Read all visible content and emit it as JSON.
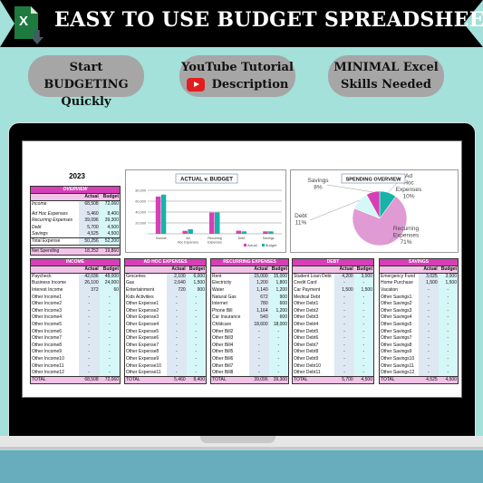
{
  "banner": {
    "title": "EASY TO USE BUDGET SPREADSHEET",
    "icon": "excel-download-icon"
  },
  "pills": [
    {
      "line1": "Start BUDGETING",
      "line2": "Quickly"
    },
    {
      "line1": "YouTube Tutorial",
      "line2": "Description",
      "icon": "youtube-icon"
    },
    {
      "line1": "MINIMAL Excel",
      "line2": "Skills Needed"
    }
  ],
  "sheet": {
    "year": "2023",
    "overview": {
      "title": "OVERVIEW",
      "col_actual": "Actual",
      "col_budget": "Budget",
      "rows": [
        {
          "label": "Income",
          "actual": "68,508",
          "budget": "72,060"
        },
        {
          "label": "Ad Hoc Expenses",
          "actual": "5,460",
          "budget": "8,400"
        },
        {
          "label": "Recurring Expenses",
          "actual": "39,096",
          "budget": "39,300"
        },
        {
          "label": "Debt",
          "actual": "5,700",
          "budget": "4,500"
        },
        {
          "label": "Savings",
          "actual": "4,525",
          "budget": "4,500"
        }
      ],
      "total": {
        "label": "Total Expense",
        "actual": "50,256",
        "budget": "52,200"
      },
      "net": {
        "label": "Net Spending",
        "actual": "18,252",
        "budget": "19,860"
      }
    },
    "sections": [
      {
        "title": "INCOME",
        "rows": [
          [
            "Paycheck",
            "42,036",
            "48,000"
          ],
          [
            "Business Income",
            "26,100",
            "24,000"
          ],
          [
            "Interest Income",
            "372",
            "60"
          ],
          [
            "Other Income1",
            "-",
            "-"
          ],
          [
            "Other Income2",
            "-",
            "-"
          ],
          [
            "Other Income3",
            "-",
            "-"
          ],
          [
            "Other Income4",
            "-",
            "-"
          ],
          [
            "Other Income5",
            "-",
            "-"
          ],
          [
            "Other Income6",
            "-",
            "-"
          ],
          [
            "Other Income7",
            "-",
            "-"
          ],
          [
            "Other Income8",
            "-",
            "-"
          ],
          [
            "Other Income9",
            "-",
            "-"
          ],
          [
            "Other Income10",
            "-",
            "-"
          ],
          [
            "Other Income11",
            "-",
            "-"
          ],
          [
            "Other Income12",
            "-",
            "-"
          ]
        ],
        "total": [
          "TOTAL",
          "68,508",
          "72,060"
        ]
      },
      {
        "title": "AD HOC EXPENSES",
        "rows": [
          [
            "Groceries",
            "2,100",
            "6,000"
          ],
          [
            "Gas",
            "2,640",
            "1,500"
          ],
          [
            "Entertainment",
            "720",
            "900"
          ],
          [
            "Kids Activities",
            "-",
            "-"
          ],
          [
            "Other Expense1",
            "-",
            "-"
          ],
          [
            "Other Expense2",
            "-",
            "-"
          ],
          [
            "Other Expense3",
            "-",
            "-"
          ],
          [
            "Other Expense4",
            "-",
            "-"
          ],
          [
            "Other Expense5",
            "-",
            "-"
          ],
          [
            "Other Expense6",
            "-",
            "-"
          ],
          [
            "Other Expense7",
            "-",
            "-"
          ],
          [
            "Other Expense8",
            "-",
            "-"
          ],
          [
            "Other Expense9",
            "-",
            "-"
          ],
          [
            "Other Expense10",
            "-",
            "-"
          ],
          [
            "Other Expense11",
            "-",
            "-"
          ]
        ],
        "total": [
          "TOTAL",
          "5,460",
          "8,400"
        ]
      },
      {
        "title": "RECURRING EXPENSES",
        "rows": [
          [
            "Rent",
            "15,000",
            "15,000"
          ],
          [
            "Electricity",
            "1,200",
            "1,800"
          ],
          [
            "Water",
            "1,140",
            "1,200"
          ],
          [
            "Natural Gas",
            "672",
            "900"
          ],
          [
            "Internet",
            "780",
            "600"
          ],
          [
            "Phone Bill",
            "1,164",
            "1,200"
          ],
          [
            "Car Insurance",
            "540",
            "600"
          ],
          [
            "Childcare",
            "18,600",
            "18,000"
          ],
          [
            "Other Bill2",
            "-",
            "-"
          ],
          [
            "Other Bill3",
            "-",
            "-"
          ],
          [
            "Other Bill4",
            "-",
            "-"
          ],
          [
            "Other Bill5",
            "-",
            "-"
          ],
          [
            "Other Bill6",
            "-",
            "-"
          ],
          [
            "Other Bill7",
            "-",
            "-"
          ],
          [
            "Other Bill8",
            "-",
            "-"
          ]
        ],
        "total": [
          "TOTAL",
          "39,096",
          "39,300"
        ]
      },
      {
        "title": "DEBT",
        "rows": [
          [
            "Student Loan Debt",
            "4,200",
            "3,000"
          ],
          [
            "Credit Card",
            "-",
            "-"
          ],
          [
            "Car Payment",
            "1,500",
            "1,500"
          ],
          [
            "Medical Debt",
            "-",
            "-"
          ],
          [
            "Other Debt1",
            "-",
            "-"
          ],
          [
            "Other Debt2",
            "-",
            "-"
          ],
          [
            "Other Debt3",
            "-",
            "-"
          ],
          [
            "Other Debt4",
            "-",
            "-"
          ],
          [
            "Other Debt5",
            "-",
            "-"
          ],
          [
            "Other Debt6",
            "-",
            "-"
          ],
          [
            "Other Debt7",
            "-",
            "-"
          ],
          [
            "Other Debt8",
            "-",
            "-"
          ],
          [
            "Other Debt9",
            "-",
            "-"
          ],
          [
            "Other Debt10",
            "-",
            "-"
          ],
          [
            "Other Debt11",
            "-",
            "-"
          ]
        ],
        "total": [
          "TOTAL",
          "5,700",
          "4,500"
        ]
      },
      {
        "title": "SAVINGS",
        "rows": [
          [
            "Emergency Fund",
            "3,025",
            "3,000"
          ],
          [
            "Home Purchase",
            "1,500",
            "1,500"
          ],
          [
            "Vacation",
            "-",
            "-"
          ],
          [
            "Other Savings1",
            "-",
            "-"
          ],
          [
            "Other Savings2",
            "-",
            "-"
          ],
          [
            "Other Savings3",
            "-",
            "-"
          ],
          [
            "Other Savings4",
            "-",
            "-"
          ],
          [
            "Other Savings5",
            "-",
            "-"
          ],
          [
            "Other Savings6",
            "-",
            "-"
          ],
          [
            "Other Savings7",
            "-",
            "-"
          ],
          [
            "Other Savings8",
            "-",
            "-"
          ],
          [
            "Other Savings9",
            "-",
            "-"
          ],
          [
            "Other Savings10",
            "-",
            "-"
          ],
          [
            "Other Savings11",
            "-",
            "-"
          ],
          [
            "Other Savings12",
            "-",
            "-"
          ]
        ],
        "total": [
          "TOTAL",
          "4,525",
          "4,500"
        ]
      }
    ]
  },
  "chart_data": [
    {
      "type": "bar",
      "title": "ACTUAL v. BUDGET",
      "categories": [
        "Income",
        "Ad Hoc Expenses",
        "Recurring Expenses",
        "Debt",
        "Savings"
      ],
      "series": [
        {
          "name": "Actual",
          "color": "#d63fb6",
          "values": [
            68508,
            5460,
            39096,
            5700,
            4525
          ]
        },
        {
          "name": "Budget",
          "color": "#17b3a8",
          "values": [
            72060,
            8400,
            39300,
            4500,
            4500
          ]
        }
      ],
      "yticks": [
        "-",
        "20,000",
        "40,000",
        "60,000",
        "80,000"
      ],
      "ylim": [
        0,
        80000
      ],
      "grid": true,
      "legend": "bottom-right"
    },
    {
      "type": "pie",
      "title": "SPENDING OVERVIEW",
      "slices": [
        {
          "label": "Ad Hoc Expenses",
          "pct": "10%",
          "value": 10,
          "color": "#17b3a8"
        },
        {
          "label": "Recurring Expenses",
          "pct": "71%",
          "value": 71,
          "color": "#e09ad4"
        },
        {
          "label": "Debt",
          "pct": "11%",
          "value": 11,
          "color": "#d6f7f7"
        },
        {
          "label": "Savings",
          "pct": "8%",
          "value": 8,
          "color": "#d63fb6"
        }
      ]
    }
  ]
}
